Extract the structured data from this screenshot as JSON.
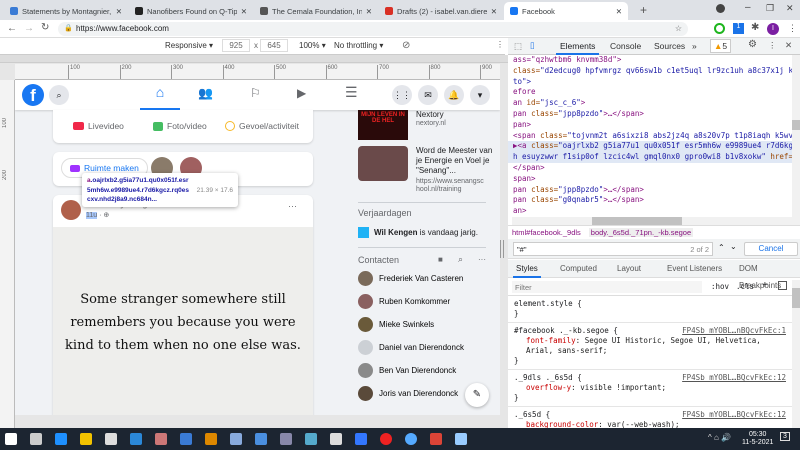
{
  "browser": {
    "tabs": [
      {
        "title": "Statements by Montagnier, Nobel",
        "color": "#3a7bd5"
      },
      {
        "title": "Nanofibers Found on Q-Tips Used",
        "color": "#222"
      },
      {
        "title": "The Cemala Foundation, Inc.",
        "color": "#555"
      },
      {
        "title": "Drafts (2) - isabel.van.dierendonck",
        "color": "#d93025"
      },
      {
        "title": "Facebook",
        "color": "#1877f2"
      }
    ],
    "new_tab": "+",
    "url": "https://www.facebook.com",
    "profile_initial": "I",
    "ext_badge": "1"
  },
  "device_toolbar": {
    "mode": "Responsive",
    "width": "925",
    "height": "645",
    "zoom": "100%",
    "throttling": "No throttling"
  },
  "devtools": {
    "tabs": [
      "Elements",
      "Console",
      "Sources"
    ],
    "more": "»",
    "warnings": "5",
    "code_lines": [
      [
        [
          "ass=\"qzhwtbm6 knvmm38d\">",
          "t"
        ]
      ],
      [
        [
          "class=",
          "an"
        ],
        [
          "\"d2edcug0 hpfvmrgz qv66sw1b c1et5uql lr9zc1uh a8c37x1j keod",
          "av"
        ]
      ],
      [
        [
          "to\">",
          "av"
        ]
      ],
      [
        [
          "efore",
          "t"
        ]
      ],
      [
        [
          "an ",
          "t"
        ],
        [
          "id=",
          "an"
        ],
        [
          "\"jsc_c_6\"",
          "av"
        ],
        [
          ">",
          "t"
        ]
      ],
      [
        [
          "pan ",
          "t"
        ],
        [
          "class=",
          "an"
        ],
        [
          "\"jpp8pzdo\"",
          "av"
        ],
        [
          ">…</span>",
          "t"
        ]
      ],
      [
        [
          "pan>",
          "t"
        ]
      ],
      [
        [
          "<span ",
          "t"
        ],
        [
          "class=",
          "an"
        ],
        [
          "\"tojvnm2t a6sixzi8 abs2jz4q a8s20v7p t1p8iaqh k5wvi7n",
          "av"
        ]
      ],
      [
        [
          "▶<a ",
          "t"
        ],
        [
          "class=",
          "an"
        ],
        [
          "\"oajrlxb2 g5ia77u1 qu0x051f esr5mh6w e9989ue4 r7d6kgcz",
          "av"
        ]
      ],
      [
        [
          "h esuyzwwr f1sip0of lzcic4wl gmql0nx0 gpro0wi8 b1v8xokw\"",
          "av"
        ],
        [
          " href=",
          "an"
        ],
        [
          "\"#\"",
          "hl"
        ]
      ],
      [
        [
          "</span>",
          "t"
        ]
      ],
      [
        [
          "span>",
          "t"
        ]
      ],
      [
        [
          "pan ",
          "t"
        ],
        [
          "class=",
          "an"
        ],
        [
          "\"jpp8pzdo\"",
          "av"
        ],
        [
          ">…</span>",
          "t"
        ]
      ],
      [
        [
          "pan ",
          "t"
        ],
        [
          "class=",
          "an"
        ],
        [
          "\"g0qnabr5\"",
          "av"
        ],
        [
          ">…</span>",
          "t"
        ]
      ],
      [
        [
          "an>",
          "t"
        ]
      ]
    ],
    "breadcrumb": [
      "html#facebook._9dls",
      "body._6s5d._71pn._-kb.segoe"
    ],
    "search": {
      "value": "\"#\"",
      "count": "2 of 2",
      "cancel": "Cancel"
    },
    "style_tabs": [
      "Styles",
      "Computed",
      "Layout",
      "Event Listeners",
      "DOM Breakpoints",
      "»"
    ],
    "filter_placeholder": "Filter",
    "hov": ":hov",
    "cls": ".cls",
    "plus": "+",
    "rules": [
      {
        "selector": "element.style {",
        "source": "",
        "props": []
      },
      {
        "selector": "#facebook ._-kb.segoe {",
        "source": "FP4Sb_mYOBL…nBQcvFkEc:1",
        "props": [
          {
            "name": "font-family",
            "value": "Segoe UI Historic, Segoe UI, Helvetica, Arial, sans-serif;"
          }
        ]
      },
      {
        "selector": "._9dls ._6s5d {",
        "source": "FP4Sb_mYOBL…BQcvFkEc:12",
        "props": [
          {
            "name": "overflow-y",
            "value": "visible !important;"
          }
        ]
      },
      {
        "selector": "._6s5d {",
        "source": "FP4Sb_mYOBL…BQcvFkEc:12",
        "props": [
          {
            "name": "background-color",
            "value": "var(--web-wash);"
          },
          {
            "name": "-webkit-font-smoothing",
            "value": "antialiased;"
          }
        ]
      }
    ]
  },
  "ruler": {
    "ticks": [
      "100",
      "200",
      "300",
      "400",
      "500",
      "600",
      "700",
      "800",
      "900"
    ],
    "vticks": [
      "100",
      "200"
    ]
  },
  "facebook": {
    "composer_actions": [
      "Livevideo",
      "Foto/video",
      "Gevoel/activiteit"
    ],
    "room_button": "Ruimte maken",
    "tooltip": {
      "tag": "a",
      "classes": ".oajrlxb2.g5ia77u1.qu0x051f.esr5mh6w.e9989ue4.r7d6kgcz.rq0escxv.nhd2j8a9.nc684n...",
      "line1": ".oajrlxb2.g5ia77u1.qu0x051f.esr",
      "line2": "5mh6w.e9989ue4.r7d6kgcz.rq0es",
      "line3": "cxv.nhd2j8a9.nc684n...",
      "size": "21.39 × 17.6"
    },
    "post": {
      "author": "Kimberley Koogman",
      "time": "11u",
      "more": "···",
      "quote": "Some stranger somewhere still remembers you because you were kind to them when no one else was."
    },
    "ads": [
      {
        "title": "Nextory",
        "url": "nextory.nl",
        "img_text": "MIJN LEVEN IN DE HEL"
      },
      {
        "title": "Word de Meester van je Energie en Voel je \"Senang\"...",
        "url": "https://www.senangschool.nl/training"
      }
    ],
    "birthdays": {
      "heading": "Verjaardagen",
      "name": "Wil Kengen",
      "text": " is vandaag jarig."
    },
    "contacts": {
      "heading": "Contacten",
      "more": "···",
      "items": [
        "Frederiek Van Casteren",
        "Ruben Komkommer",
        "Mieke Swinkels",
        "Daniel van Dierendonck",
        "Ben Van Dierendonck",
        "Joris van Dierendonck"
      ]
    }
  },
  "taskbar": {
    "time": "05:30",
    "date": "11-5-2021",
    "notifications": "3"
  },
  "colors": {
    "fb_blue": "#1877f2",
    "devtools_blue": "#1a73e8",
    "taskbar": "#1c2531"
  }
}
